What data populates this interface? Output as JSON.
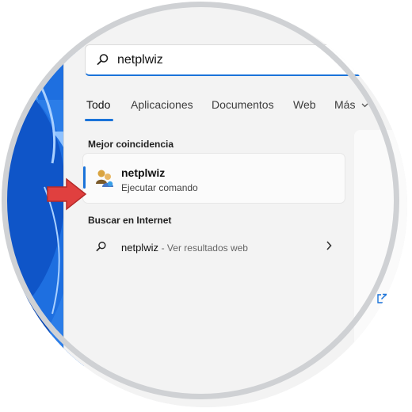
{
  "search": {
    "query": "netplwiz",
    "icon": "search-icon"
  },
  "tabs": [
    {
      "label": "Todo",
      "active": true
    },
    {
      "label": "Aplicaciones",
      "active": false
    },
    {
      "label": "Documentos",
      "active": false
    },
    {
      "label": "Web",
      "active": false
    },
    {
      "label": "Más",
      "active": false,
      "icon": "chevron-down-icon"
    }
  ],
  "best_match": {
    "heading": "Mejor coincidencia",
    "name": "netplwiz",
    "subtitle": "Ejecutar comando",
    "icon": "users-icon"
  },
  "web_search": {
    "heading": "Buscar en Internet",
    "query": "netplwiz",
    "hint": "- Ver resultados web",
    "icon": "search-icon",
    "arrow_icon": "chevron-right-icon"
  },
  "preview": {
    "icon": "open-external-icon"
  },
  "colors": {
    "accent": "#1a73d9",
    "pointer": "#e0403f",
    "panel": "#f3f3f3"
  }
}
